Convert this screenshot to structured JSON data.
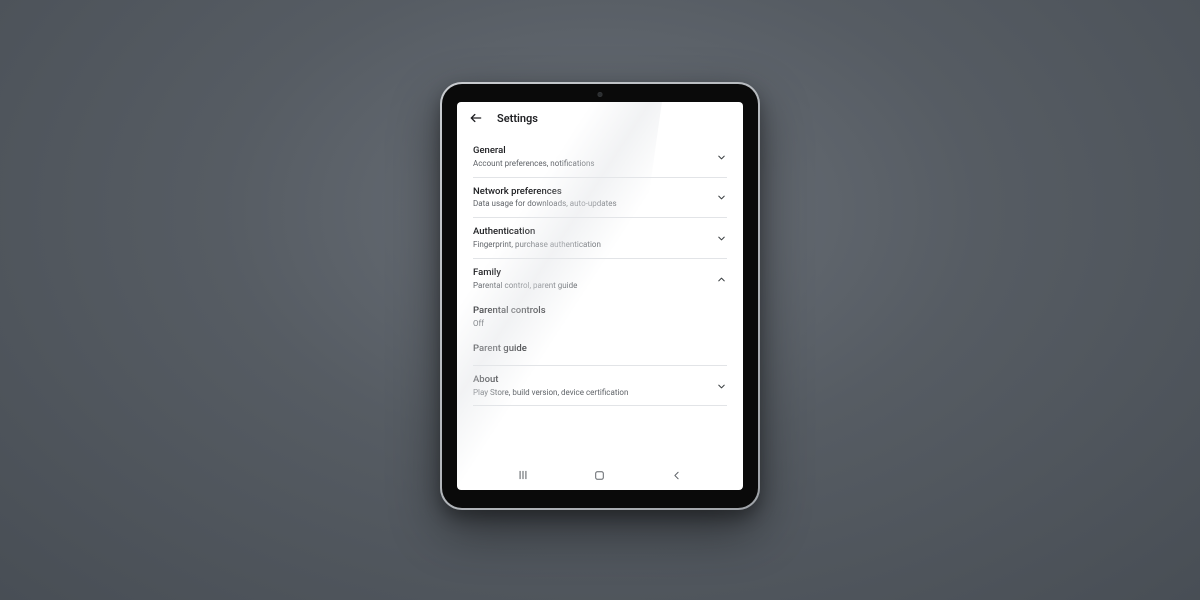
{
  "header": {
    "title": "Settings"
  },
  "sections": {
    "general": {
      "title": "General",
      "sub": "Account preferences, notifications"
    },
    "network": {
      "title": "Network preferences",
      "sub": "Data usage for downloads, auto-updates"
    },
    "auth": {
      "title": "Authentication",
      "sub": "Fingerprint, purchase authentication"
    },
    "family": {
      "title": "Family",
      "sub": "Parental control, parent guide"
    },
    "about": {
      "title": "About",
      "sub": "Play Store, build version, device certification"
    }
  },
  "family_children": {
    "parental_controls": {
      "title": "Parental controls",
      "sub": "Off"
    },
    "parent_guide": {
      "title": "Parent guide"
    }
  }
}
